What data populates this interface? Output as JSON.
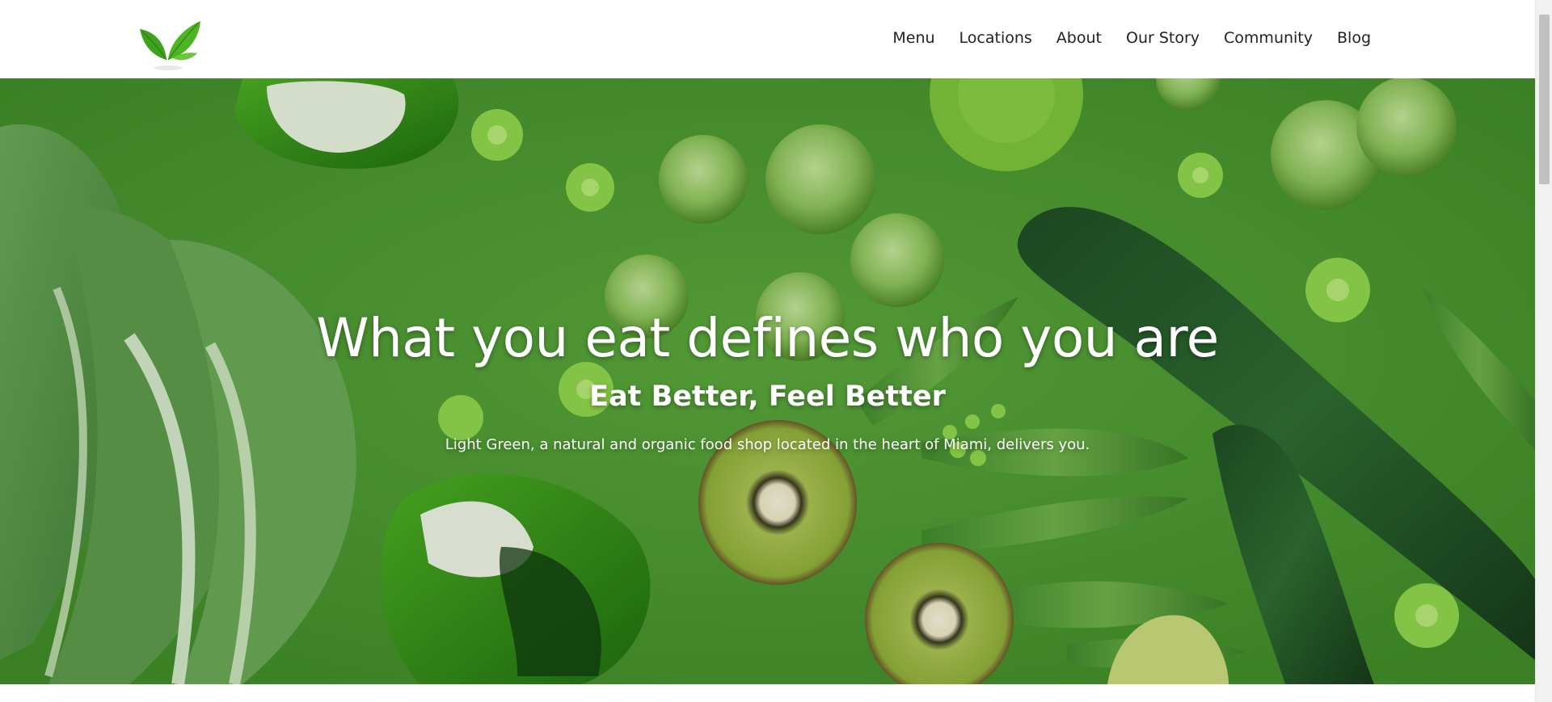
{
  "brand": {
    "logo_icon": "leaf-logo-icon",
    "accent": "#3a9a1e"
  },
  "nav": {
    "items": [
      {
        "label": "Menu"
      },
      {
        "label": "Locations"
      },
      {
        "label": "About"
      },
      {
        "label": "Our Story"
      },
      {
        "label": "Community"
      },
      {
        "label": "Blog"
      }
    ]
  },
  "hero": {
    "title": "What you eat defines who you are",
    "subtitle": "Eat Better, Feel Better",
    "description": "Light Green, a natural and organic food shop located in the heart of Miami, delivers you.",
    "background_color": "#4f9a33",
    "image_subject": "vegetables-flatlay-image"
  }
}
